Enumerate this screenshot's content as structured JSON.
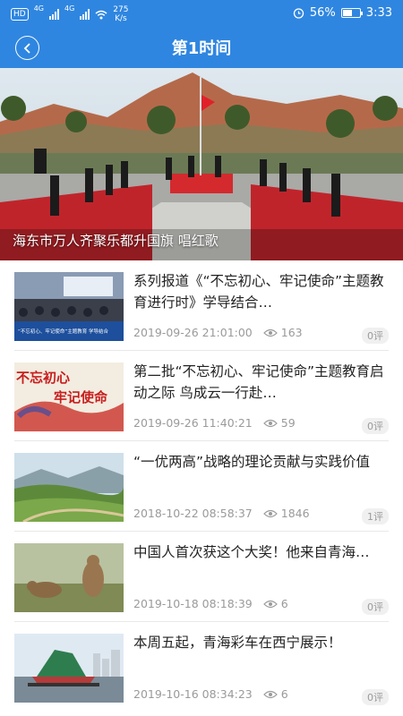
{
  "status_bar": {
    "hd": "HD",
    "net1": "4G",
    "net2": "4G",
    "speed_value": "275",
    "speed_unit": "K/s",
    "battery": "56%",
    "battery_level": 0.56,
    "time": "3:33"
  },
  "header": {
    "title": "第1时间",
    "accent": "#2f86e0"
  },
  "hero": {
    "caption": "海东市万人齐聚乐都升国旗 唱红歌"
  },
  "articles": [
    {
      "title": "系列报道《“不忘初心、牢记使命”主题教育进行时》学导结合…",
      "date": "2019-09-26 21:01:00",
      "views": "163",
      "comments": "0评"
    },
    {
      "title": "第二批“不忘初心、牢记使命”主题教育启动之际 鸟成云一行赴…",
      "date": "2019-09-26 11:40:21",
      "views": "59",
      "comments": "0评"
    },
    {
      "title": "“一优两高”战略的理论贡献与实践价值",
      "date": "2018-10-22 08:58:37",
      "views": "1846",
      "comments": "1评"
    },
    {
      "title": "中国人首次获这个大奖！他来自青海…",
      "date": "2019-10-18 08:18:39",
      "views": "6",
      "comments": "0评"
    },
    {
      "title": "本周五起，青海彩车在西宁展示！",
      "date": "2019-10-16 08:34:23",
      "views": "6",
      "comments": "0评"
    }
  ],
  "thumb_texts": {
    "a1_banner": "“不忘初心、牢记使命”主题教育 学导结合",
    "a2_line1": "不忘初心",
    "a2_line2": "牢记使命"
  }
}
